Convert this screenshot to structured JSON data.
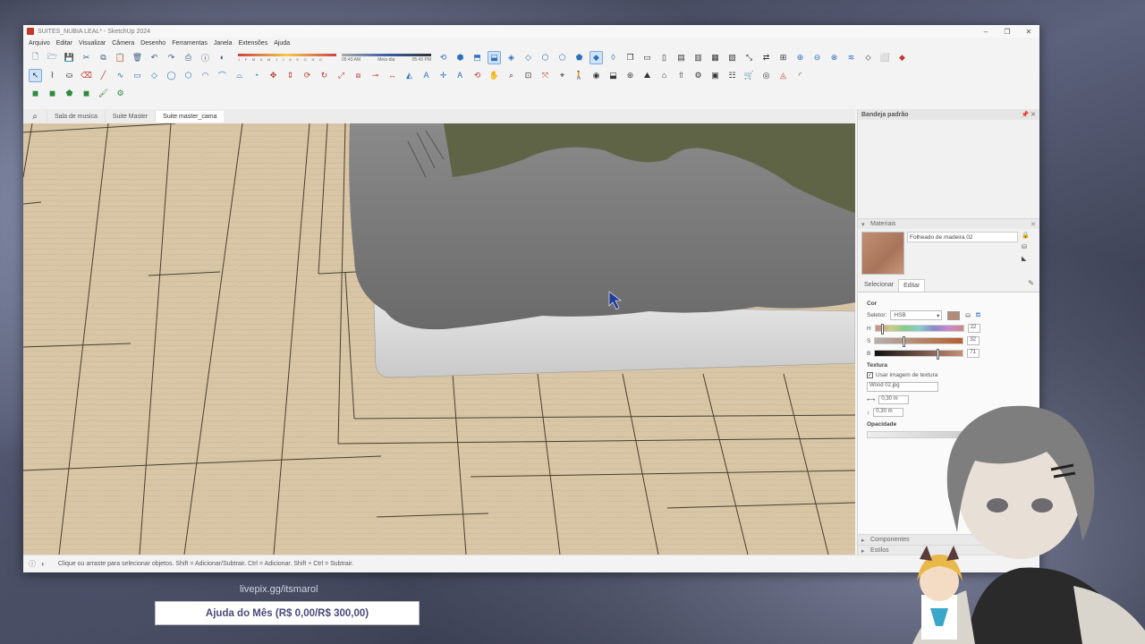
{
  "window": {
    "title": "SUITES_NUBIA LEAL* - SketchUp 2024",
    "controls": [
      "–",
      "❐",
      "✕"
    ]
  },
  "menu": [
    "Arquivo",
    "Editar",
    "Visualizar",
    "Câmera",
    "Desenho",
    "Ferramentas",
    "Janela",
    "Extensões",
    "Ajuda"
  ],
  "shadows": {
    "months": "J F M A M J J A S O N D",
    "time_start": "05:43 AM",
    "time_mid": "Meio-dia",
    "time_end": "05:43 PM"
  },
  "scene_tabs": {
    "search_icon": "search-icon",
    "tabs": [
      "Sala de musica",
      "Suite Master",
      "Suite master_cama"
    ],
    "active_index": 2
  },
  "tray": {
    "title": "Bandeja padrão",
    "materials_heading": "Materiais",
    "material_name": "Folheado de madeira 02",
    "subtabs": [
      "Selecionar",
      "Editar"
    ],
    "active_subtab": 1,
    "color_heading": "Cor",
    "selector_label": "Seletor:",
    "selector_value": "HSB",
    "h_label": "H",
    "h_value": "22",
    "h_fraction": 0.06,
    "s_label": "S",
    "s_value": "32",
    "s_fraction": 0.32,
    "b_label": "B",
    "b_value": "71",
    "b_fraction": 0.71,
    "texture_heading": "Textura",
    "use_texture_label": "Usar imagem de textura",
    "use_texture_checked": "✓",
    "texture_file": "Wood 02.jpg",
    "width_value": "0,30 m",
    "height_value": "0,30 m",
    "opacity_heading": "Opacidade",
    "components_heading": "Componentes",
    "styles_heading": "Estilos"
  },
  "status": {
    "text": "Clique ou arraste para selecionar objetos. Shift = Adicionar/Subtrair. Ctrl = Adicionar. Shift + Ctrl = Subtrair."
  },
  "overlay": {
    "livepix": "livepix.gg/itsmarol",
    "goal": "Ajuda do Mês (R$ 0,00/R$ 300,00)"
  },
  "colors": {
    "floor": "#d8c6a6",
    "blanket": "#7a7a7a",
    "quilt": "#5f6447",
    "accent": "#3a5ca9"
  }
}
